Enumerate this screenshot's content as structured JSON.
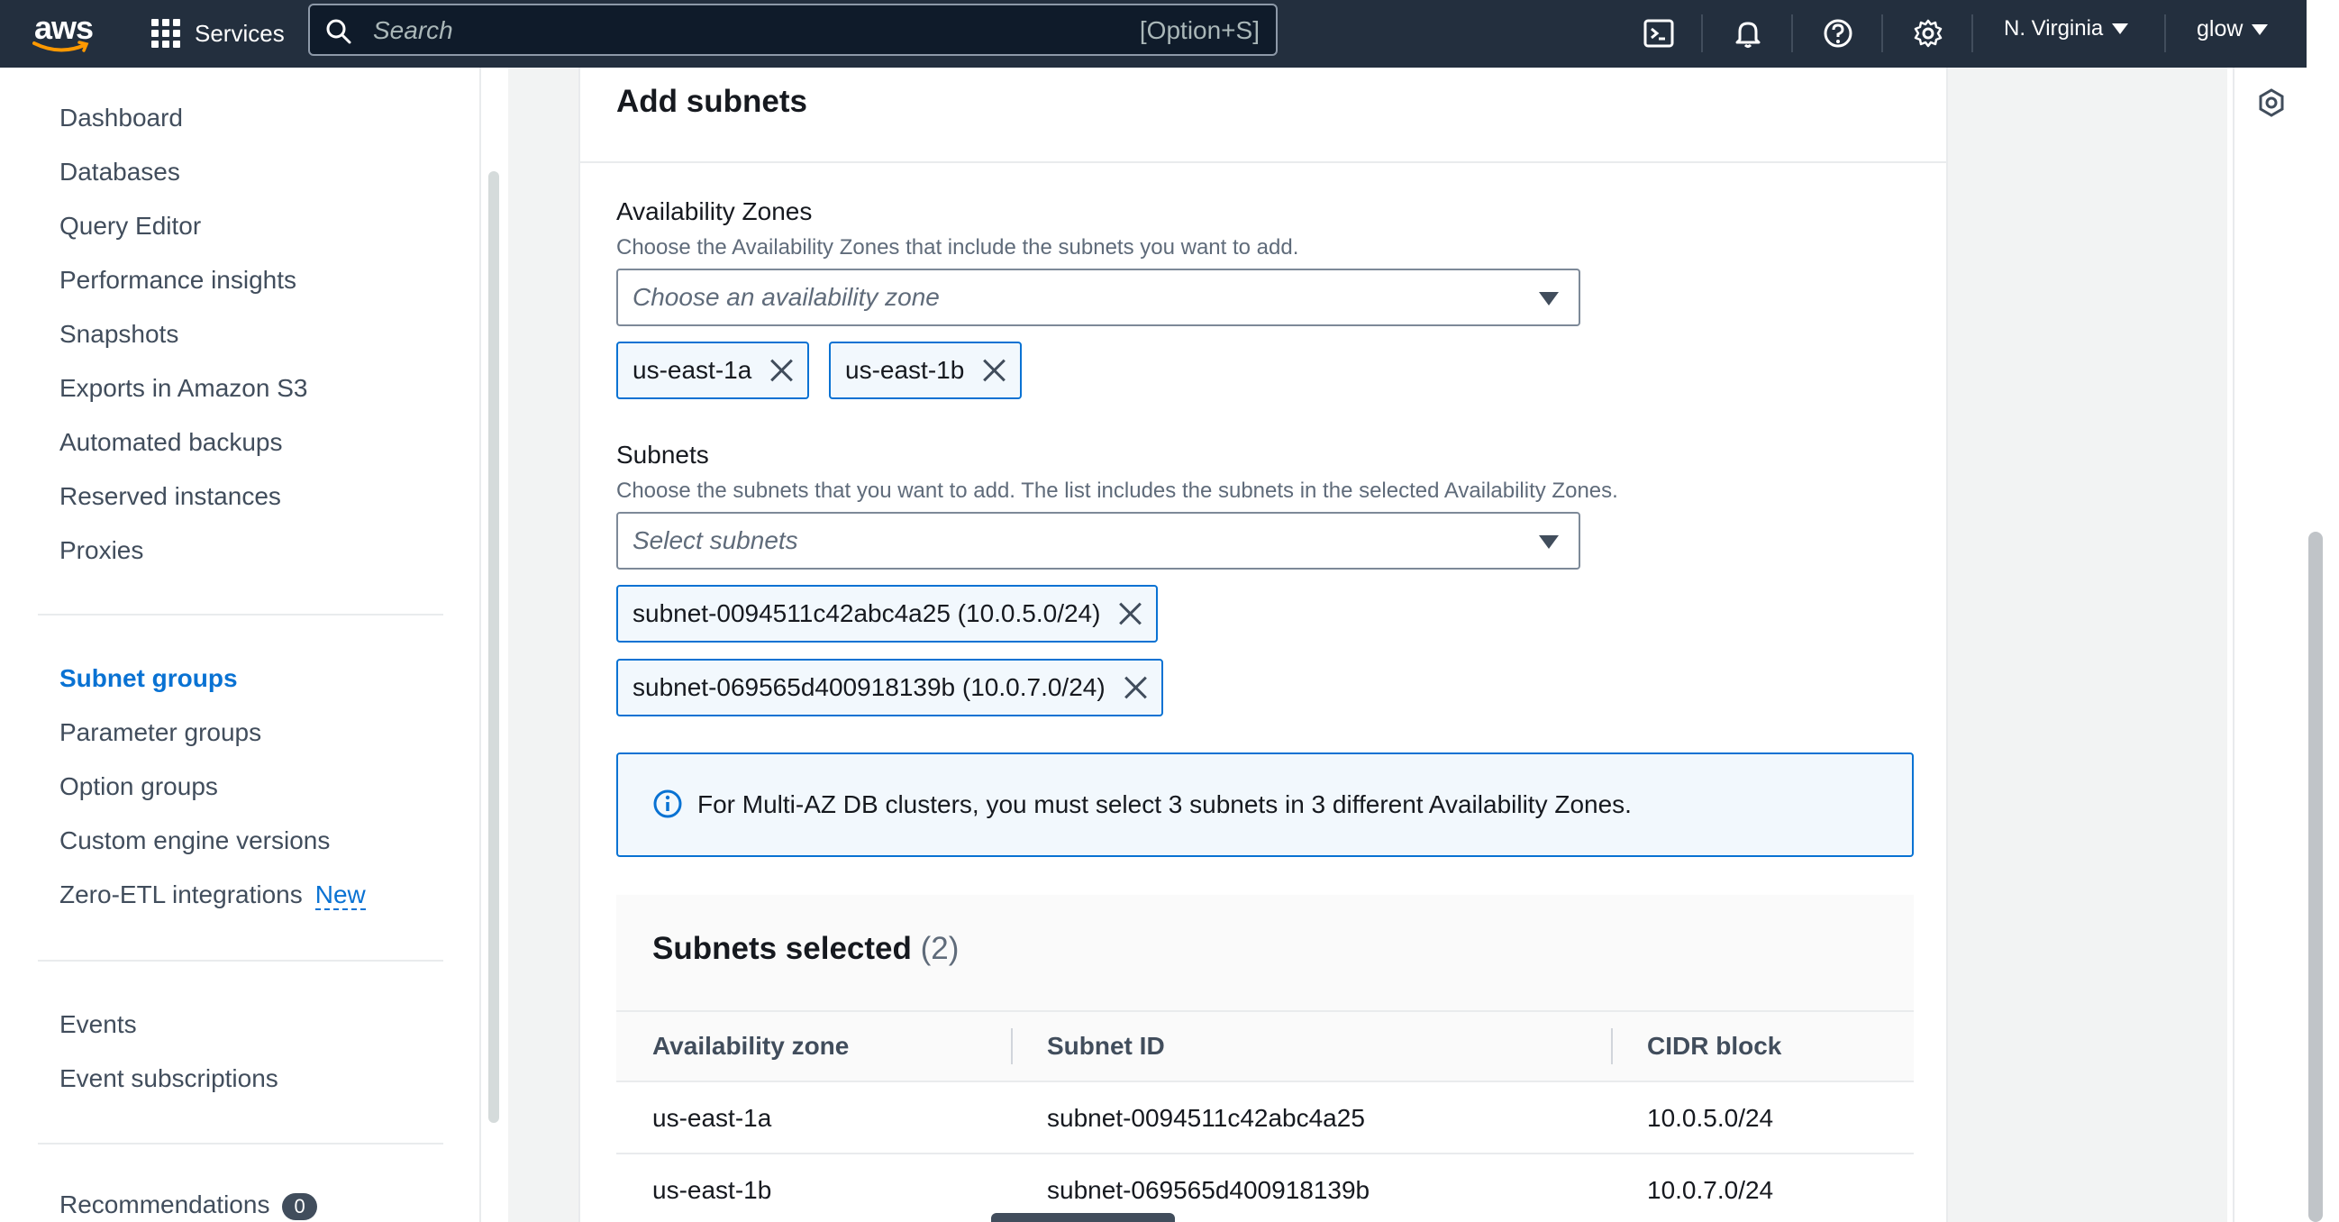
{
  "topbar": {
    "logo_text": "aws",
    "services_label": "Services",
    "search_placeholder": "Search",
    "search_shortcut": "[Option+S]",
    "region": "N. Virginia",
    "user": "glow"
  },
  "sidebar": {
    "items": [
      {
        "label": "Dashboard"
      },
      {
        "label": "Databases"
      },
      {
        "label": "Query Editor"
      },
      {
        "label": "Performance insights"
      },
      {
        "label": "Snapshots"
      },
      {
        "label": "Exports in Amazon S3"
      },
      {
        "label": "Automated backups"
      },
      {
        "label": "Reserved instances"
      },
      {
        "label": "Proxies"
      },
      {
        "label": "Subnet groups"
      },
      {
        "label": "Parameter groups"
      },
      {
        "label": "Option groups"
      },
      {
        "label": "Custom engine versions"
      },
      {
        "label": "Zero-ETL integrations"
      },
      {
        "label": "Events"
      },
      {
        "label": "Event subscriptions"
      },
      {
        "label": "Recommendations"
      }
    ],
    "active_item": "Subnet groups",
    "new_badge": "New",
    "recommendations_count": "0"
  },
  "main": {
    "section_title": "Add subnets",
    "az": {
      "label": "Availability Zones",
      "description": "Choose the Availability Zones that include the subnets you want to add.",
      "placeholder": "Choose an availability zone",
      "tokens": [
        "us-east-1a",
        "us-east-1b"
      ]
    },
    "subnets": {
      "label": "Subnets",
      "description": "Choose the subnets that you want to add. The list includes the subnets in the selected Availability Zones.",
      "placeholder": "Select subnets",
      "tokens": [
        "subnet-0094511c42abc4a25 (10.0.5.0/24)",
        "subnet-069565d400918139b (10.0.7.0/24)"
      ]
    },
    "alert": "For Multi-AZ DB clusters, you must select 3 subnets in 3 different Availability Zones.",
    "selected": {
      "title": "Subnets selected",
      "count": "(2)",
      "columns": [
        "Availability zone",
        "Subnet ID",
        "CIDR block"
      ],
      "rows": [
        [
          "us-east-1a",
          "subnet-0094511c42abc4a25",
          "10.0.5.0/24"
        ],
        [
          "us-east-1b",
          "subnet-069565d400918139b",
          "10.0.7.0/24"
        ]
      ]
    }
  },
  "colors": {
    "nav_bg": "#232f3e",
    "accent": "#0972d3",
    "alert_bg": "#f2f8fd"
  },
  "icons": [
    "grid-icon",
    "search-icon",
    "cloudshell-icon",
    "bell-icon",
    "help-icon",
    "settings-icon",
    "info-icon",
    "close-icon",
    "panel-icon"
  ]
}
